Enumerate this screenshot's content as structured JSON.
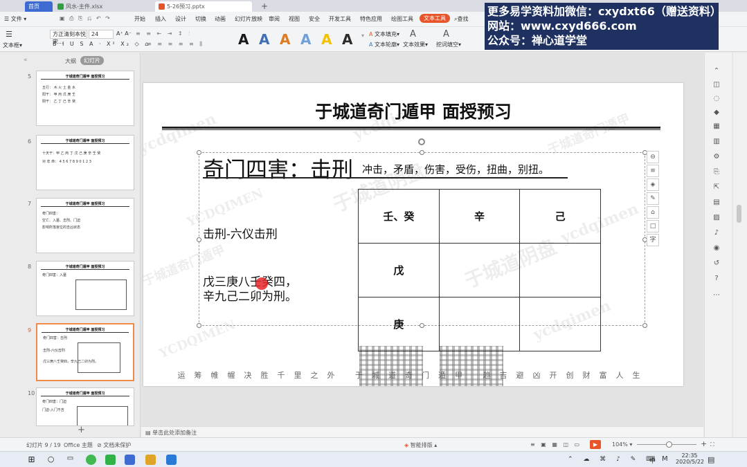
{
  "tabs": {
    "home": "首页",
    "excel": "风水-主件.xlsx",
    "ppt": "5-26预习.pptx",
    "new_tab": "+"
  },
  "menu": {
    "file": "文件",
    "items": [
      "开始",
      "插入",
      "设计",
      "切换",
      "动画",
      "幻灯片放映",
      "审阅",
      "视图",
      "安全",
      "开发工具",
      "特色应用",
      "绘图工具"
    ],
    "text_tool": "文本工具",
    "search": "查找"
  },
  "ribbon": {
    "textbox_label": "文本框",
    "font_name": "方正清刻本悦宋...",
    "font_size": "24",
    "text_fill": "文本填充",
    "text_outline": "文本轮廓",
    "text_effect": "文本效果",
    "form_fill": "挖词填空",
    "styles": [
      "A",
      "A",
      "A",
      "A",
      "A",
      "A"
    ],
    "style_colors": [
      "#1a1a1a",
      "#3f6fb5",
      "#e07b22",
      "#6fa0d8",
      "#f2c200",
      "#2b2b2b"
    ]
  },
  "promo": {
    "line1": "更多易学资料加微信：cxydxt66（赠送资料）",
    "line2": "网站：www.cxyd666.com",
    "line3": "公众号：禅心道学堂"
  },
  "left_panel": {
    "outline_tab": "大纲",
    "slides_tab": "幻灯片",
    "add_button": "+",
    "thumbs": [
      {
        "num": "5",
        "title": "于城道奇门遁甲 面授预习",
        "lines": [
          "五行： 木 火 土 金 水",
          "阳干： 甲 丙 戊 庚 壬",
          "阴干： 乙 丁 己 辛 癸"
        ]
      },
      {
        "num": "6",
        "title": "于城道奇门遁甲 面授预习",
        "lines": [
          "十天干：甲 乙 丙 丁 戊 己 庚 辛 壬 癸",
          "对 年 命： 4 5 6 7 8 9 0 1 2 3"
        ]
      },
      {
        "num": "7",
        "title": "于城道奇门遁甲 面授预习",
        "lines": [
          "奇门四害：",
          "空亡、入墓、击刑、门迫",
          "影响所落宫位的吉凶状态"
        ]
      },
      {
        "num": "8",
        "title": "于城道奇门遁甲 面授预习",
        "lines": [
          "奇门四害：入墓"
        ]
      },
      {
        "num": "9",
        "title": "于城道奇门遁甲 面授预习",
        "lines": [
          "奇门四害：击刑",
          "击刑-六仪击刑",
          "戊三庚八壬癸四，辛九己二卯为刑。"
        ]
      },
      {
        "num": "10",
        "title": "于城道奇门遁甲 面授预习",
        "lines": [
          "奇门四害：门迫",
          "门迫-入门不吉"
        ]
      }
    ]
  },
  "slide": {
    "title": "于城道奇门遁甲 面授预习",
    "heading": "奇门四害：击刑",
    "heading_desc": "冲击，矛盾，伤害，受伤，扭曲，别扭。",
    "body1": "击刑-六仪击刑",
    "body2_line1": "戊三庚八壬癸四，",
    "body2_line2": "辛九己二卯为刑。",
    "grid": [
      [
        "壬、癸",
        "辛",
        "己"
      ],
      [
        "戊",
        "",
        ""
      ],
      [
        "庚",
        "",
        ""
      ]
    ],
    "footer": "运筹帷幄决胜千里之外 于城道奇门遁甲 趋吉避凶开创财富人生",
    "watermark_cn": "于城道奇门遁甲",
    "watermark_en": "YCDQIMEN",
    "watermark_script": "ycdqimen",
    "watermark_brand": "于城道阴盘"
  },
  "notes": {
    "placeholder": "单击此处添加备注"
  },
  "status": {
    "slide_info": "幻灯片 9 / 19",
    "theme": "Office 主题",
    "protect": "文档未保护",
    "smart": "智能排版",
    "zoom": "104%"
  },
  "taskbar": {
    "time": "22:35",
    "date": "2020/5/22",
    "ime": "中"
  }
}
